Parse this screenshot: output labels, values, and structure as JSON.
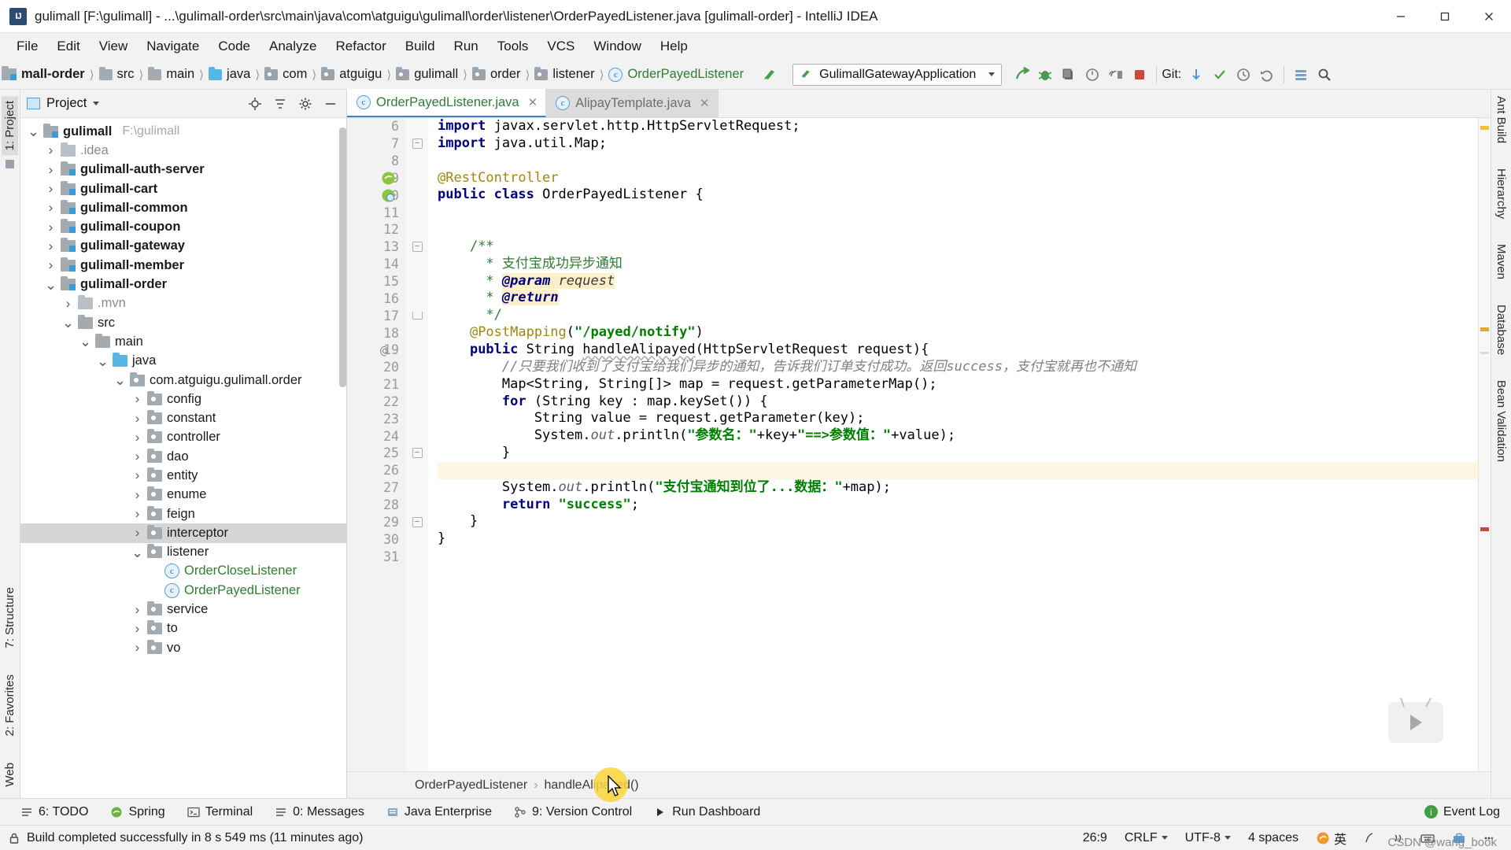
{
  "window": {
    "title": "gulimall [F:\\gulimall] - ...\\gulimall-order\\src\\main\\java\\com\\atguigu\\gulimall\\order\\listener\\OrderPayedListener.java [gulimall-order] - IntelliJ IDEA",
    "app_badge": "IJ",
    "minimize": "—",
    "maximize": "☐",
    "close": "✕"
  },
  "menubar": {
    "items": [
      "File",
      "Edit",
      "View",
      "Navigate",
      "Code",
      "Analyze",
      "Refactor",
      "Build",
      "Run",
      "Tools",
      "VCS",
      "Window",
      "Help"
    ]
  },
  "breadcrumbs": {
    "items": [
      {
        "label": "mall-order",
        "icon": "module-icon",
        "bold": true
      },
      {
        "label": "src",
        "icon": "folder-icon"
      },
      {
        "label": "main",
        "icon": "folder-icon"
      },
      {
        "label": "java",
        "icon": "source-folder-icon"
      },
      {
        "label": "com",
        "icon": "package-icon"
      },
      {
        "label": "atguigu",
        "icon": "package-icon"
      },
      {
        "label": "gulimall",
        "icon": "package-icon"
      },
      {
        "label": "order",
        "icon": "package-icon"
      },
      {
        "label": "listener",
        "icon": "package-icon"
      },
      {
        "label": "OrderPayedListener",
        "icon": "class-icon",
        "green": true
      }
    ]
  },
  "toolbar": {
    "run_config": "GulimallGatewayApplication",
    "run_icon": "run-icon",
    "debug_icon": "debug-icon",
    "run_with_coverage_icon": "coverage-icon",
    "profile_icon": "profile-icon",
    "attach_icon": "attach-icon",
    "stop_icon": "stop-icon",
    "git_label": "Git:",
    "git_update_icon": "update-project-icon",
    "git_commit_icon": "commit-icon",
    "git_history_icon": "history-icon",
    "git_revert_icon": "revert-icon",
    "search_icon": "search-icon",
    "settings_icon": "settings-icon"
  },
  "project_panel": {
    "header_title": "Project",
    "header_icons": [
      "locate-icon",
      "collapse-all-icon",
      "gear-icon",
      "hide-icon"
    ],
    "tree": [
      {
        "depth": 0,
        "label": "gulimall",
        "suffix": "F:\\gulimall",
        "icon": "module-icon",
        "arrow": "down",
        "bold": true
      },
      {
        "depth": 1,
        "label": ".idea",
        "icon": "folder-light-icon",
        "arrow": "right",
        "muted": true
      },
      {
        "depth": 1,
        "label": "gulimall-auth-server",
        "icon": "module-icon",
        "arrow": "right",
        "bold": true
      },
      {
        "depth": 1,
        "label": "gulimall-cart",
        "icon": "module-icon",
        "arrow": "right",
        "bold": true
      },
      {
        "depth": 1,
        "label": "gulimall-common",
        "icon": "module-icon",
        "arrow": "right",
        "bold": true
      },
      {
        "depth": 1,
        "label": "gulimall-coupon",
        "icon": "module-icon",
        "arrow": "right",
        "bold": true
      },
      {
        "depth": 1,
        "label": "gulimall-gateway",
        "icon": "module-icon",
        "arrow": "right",
        "bold": true
      },
      {
        "depth": 1,
        "label": "gulimall-member",
        "icon": "module-icon",
        "arrow": "right",
        "bold": true
      },
      {
        "depth": 1,
        "label": "gulimall-order",
        "icon": "module-icon",
        "arrow": "down",
        "bold": true
      },
      {
        "depth": 2,
        "label": ".mvn",
        "icon": "folder-light-icon",
        "arrow": "right",
        "muted": true
      },
      {
        "depth": 2,
        "label": "src",
        "icon": "folder-icon",
        "arrow": "down"
      },
      {
        "depth": 3,
        "label": "main",
        "icon": "folder-icon",
        "arrow": "down"
      },
      {
        "depth": 4,
        "label": "java",
        "icon": "source-folder-icon",
        "arrow": "down"
      },
      {
        "depth": 5,
        "label": "com.atguigu.gulimall.order",
        "icon": "package-icon",
        "arrow": "down"
      },
      {
        "depth": 6,
        "label": "config",
        "icon": "package-icon",
        "arrow": "right"
      },
      {
        "depth": 6,
        "label": "constant",
        "icon": "package-icon",
        "arrow": "right"
      },
      {
        "depth": 6,
        "label": "controller",
        "icon": "package-icon",
        "arrow": "right"
      },
      {
        "depth": 6,
        "label": "dao",
        "icon": "package-icon",
        "arrow": "right"
      },
      {
        "depth": 6,
        "label": "entity",
        "icon": "package-icon",
        "arrow": "right"
      },
      {
        "depth": 6,
        "label": "enume",
        "icon": "package-icon",
        "arrow": "right"
      },
      {
        "depth": 6,
        "label": "feign",
        "icon": "package-icon",
        "arrow": "right"
      },
      {
        "depth": 6,
        "label": "interceptor",
        "icon": "package-icon",
        "arrow": "right",
        "selected": true
      },
      {
        "depth": 6,
        "label": "listener",
        "icon": "package-icon",
        "arrow": "down"
      },
      {
        "depth": 7,
        "label": "OrderCloseListener",
        "icon": "class-icon",
        "arrow": "none",
        "green": true
      },
      {
        "depth": 7,
        "label": "OrderPayedListener",
        "icon": "class-icon",
        "arrow": "none",
        "green": true
      },
      {
        "depth": 6,
        "label": "service",
        "icon": "package-icon",
        "arrow": "right"
      },
      {
        "depth": 6,
        "label": "to",
        "icon": "package-icon",
        "arrow": "right"
      },
      {
        "depth": 6,
        "label": "vo",
        "icon": "package-icon",
        "arrow": "right"
      }
    ]
  },
  "left_strip": {
    "tabs": [
      {
        "label": "1: Project",
        "selected": true,
        "icon": "project-icon"
      },
      {
        "label": "7: Structure",
        "selected": false,
        "icon": "structure-icon"
      },
      {
        "label": "2: Favorites",
        "selected": false,
        "icon": "star-icon"
      },
      {
        "label": "Web",
        "selected": false,
        "icon": "web-icon"
      }
    ]
  },
  "right_strip": {
    "tabs": [
      {
        "label": "Ant Build",
        "icon": "ant-icon"
      },
      {
        "label": "Hierarchy",
        "icon": "hierarchy-icon"
      },
      {
        "label": "Maven",
        "icon": "maven-icon"
      },
      {
        "label": "Database",
        "icon": "database-icon"
      },
      {
        "label": "Bean Validation",
        "icon": "bean-icon"
      }
    ]
  },
  "editor": {
    "tabs": [
      {
        "label": "OrderPayedListener.java",
        "active": true,
        "icon": "class-icon",
        "close": "✕"
      },
      {
        "label": "AlipayTemplate.java",
        "active": false,
        "icon": "class-icon",
        "close": "✕"
      }
    ],
    "first_line_number": 6,
    "lines": [
      {
        "n": 6,
        "text": "import javax.servlet.http.HttpServletRequest;"
      },
      {
        "n": 7,
        "text": "import java.util.Map;"
      },
      {
        "n": 8,
        "text": ""
      },
      {
        "n": 9,
        "text": "@RestController"
      },
      {
        "n": 10,
        "text": "public class OrderPayedListener {"
      },
      {
        "n": 11,
        "text": ""
      },
      {
        "n": 12,
        "text": ""
      },
      {
        "n": 13,
        "text": "    /**"
      },
      {
        "n": 14,
        "text": "     * 支付宝成功异步通知"
      },
      {
        "n": 15,
        "text": "     * @param request"
      },
      {
        "n": 16,
        "text": "     * @return"
      },
      {
        "n": 17,
        "text": "     */"
      },
      {
        "n": 18,
        "text": "    @PostMapping(\"/payed/notify\")"
      },
      {
        "n": 19,
        "text": "    public String handleAlipayed(HttpServletRequest request){"
      },
      {
        "n": 20,
        "text": "        //只要我们收到了支付宝给我们异步的通知，告诉我们订单支付成功。返回success，支付宝就再也不通知"
      },
      {
        "n": 21,
        "text": "        Map<String, String[]> map = request.getParameterMap();"
      },
      {
        "n": 22,
        "text": "        for (String key : map.keySet()) {"
      },
      {
        "n": 23,
        "text": "            String value = request.getParameter(key);"
      },
      {
        "n": 24,
        "text": "            System.out.println(\"参数名：\"+key+\"==>参数值：\"+value);"
      },
      {
        "n": 25,
        "text": "        }"
      },
      {
        "n": 26,
        "text": "",
        "highlighted": true
      },
      {
        "n": 27,
        "text": "        System.out.println(\"支付宝通知到位了...数据：\"+map);"
      },
      {
        "n": 28,
        "text": "        return \"success\";"
      },
      {
        "n": 29,
        "text": "    }"
      },
      {
        "n": 30,
        "text": "}"
      },
      {
        "n": 31,
        "text": ""
      }
    ],
    "breadcrumb": {
      "class": "OrderPayedListener",
      "separator": "›",
      "method": "handleAlipayed()"
    }
  },
  "tool_windows": {
    "items": [
      {
        "label": "6: TODO",
        "icon": "todo-icon",
        "mnemonic": "6"
      },
      {
        "label": "Spring",
        "icon": "spring-icon"
      },
      {
        "label": "Terminal",
        "icon": "terminal-icon"
      },
      {
        "label": "0: Messages",
        "icon": "messages-icon",
        "mnemonic": "0"
      },
      {
        "label": "Java Enterprise",
        "icon": "java-ee-icon"
      },
      {
        "label": "9: Version Control",
        "icon": "vcs-icon",
        "mnemonic": "9"
      },
      {
        "label": "Run Dashboard",
        "icon": "run-dashboard-icon"
      }
    ],
    "event_log": "Event Log",
    "event_log_badge": "i"
  },
  "status_bar": {
    "message": "Build completed successfully in 8 s 549 ms (11 minutes ago)",
    "caret_position": "26:9",
    "line_separator": "CRLF",
    "encoding": "UTF-8",
    "indent": "4 spaces",
    "ime": "英",
    "watermark": "CSDN @wang_book"
  }
}
